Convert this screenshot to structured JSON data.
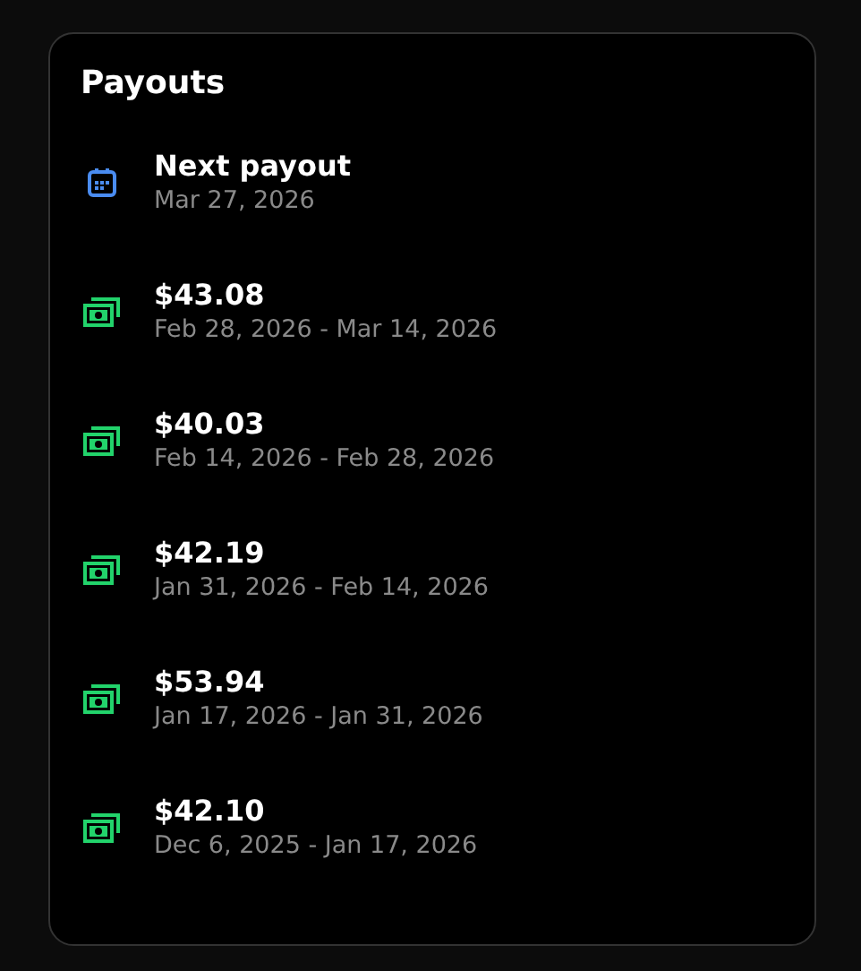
{
  "payouts": {
    "title": "Payouts",
    "items": [
      {
        "kind": "calendar",
        "title": "Next payout",
        "subtitle": "Mar 27, 2026"
      },
      {
        "kind": "cash",
        "title": "$43.08",
        "subtitle": "Feb 28, 2026 - Mar 14, 2026"
      },
      {
        "kind": "cash",
        "title": "$40.03",
        "subtitle": "Feb 14, 2026 - Feb 28, 2026"
      },
      {
        "kind": "cash",
        "title": "$42.19",
        "subtitle": "Jan 31, 2026 - Feb 14, 2026"
      },
      {
        "kind": "cash",
        "title": "$53.94",
        "subtitle": "Jan 17, 2026 - Jan 31, 2026"
      },
      {
        "kind": "cash",
        "title": "$42.10",
        "subtitle": "Dec 6, 2025 - Jan 17, 2026"
      }
    ]
  }
}
